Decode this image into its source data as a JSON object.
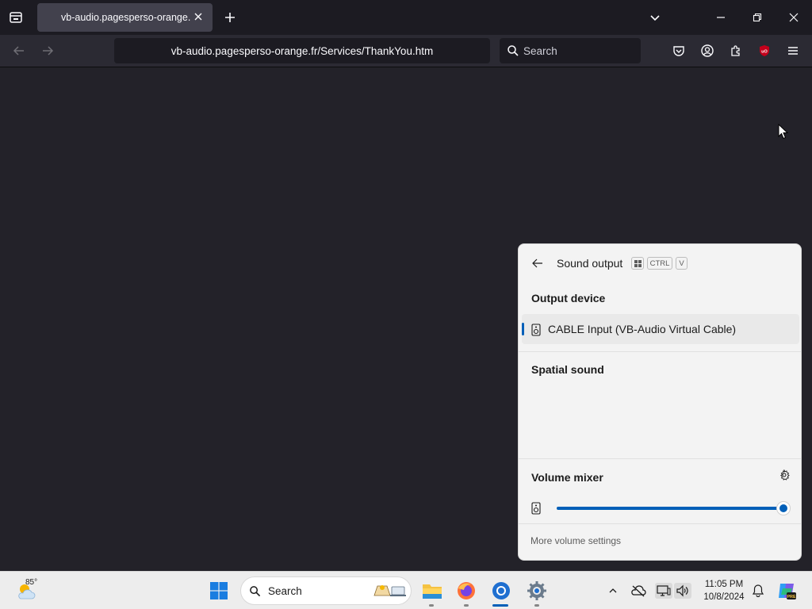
{
  "browser": {
    "tab_title": "vb-audio.pagesperso-orange.fr",
    "url": "vb-audio.pagesperso-orange.fr/Services/ThankYou.htm",
    "search_placeholder": "Search"
  },
  "flyout": {
    "title": "Sound output",
    "shortcut_keys": [
      "CTRL",
      "V"
    ],
    "output_device_heading": "Output device",
    "selected_device": "CABLE Input (VB-Audio Virtual Cable)",
    "spatial_heading": "Spatial sound",
    "volume_heading": "Volume mixer",
    "volume_level_percent": 100,
    "more_volume_link": "More volume settings"
  },
  "taskbar": {
    "weather_temp": "85°",
    "search_label": "Search",
    "time": "11:05 PM",
    "date": "10/8/2024"
  },
  "colors": {
    "accent": "#005fb8",
    "browser_chrome": "#1c1b22",
    "content_bg": "#232229"
  }
}
